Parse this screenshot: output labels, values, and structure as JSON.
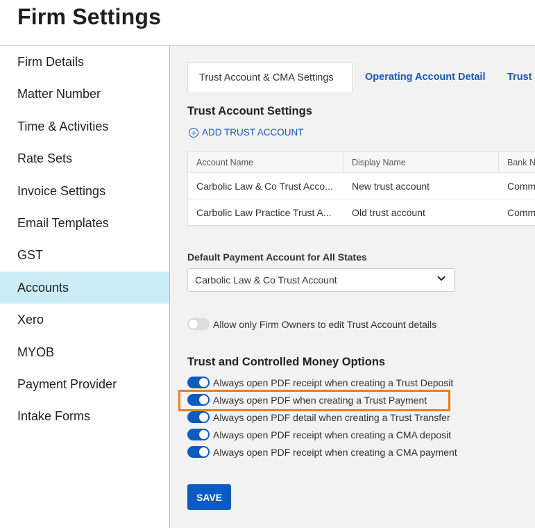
{
  "page_title": "Firm Settings",
  "sidebar": {
    "items": [
      {
        "label": "Firm Details"
      },
      {
        "label": "Matter Number"
      },
      {
        "label": "Time & Activities"
      },
      {
        "label": "Rate Sets"
      },
      {
        "label": "Invoice Settings"
      },
      {
        "label": "Email Templates"
      },
      {
        "label": "GST"
      },
      {
        "label": "Accounts",
        "active": true
      },
      {
        "label": "Xero"
      },
      {
        "label": "MYOB"
      },
      {
        "label": "Payment Provider"
      },
      {
        "label": "Intake Forms"
      }
    ]
  },
  "tabs": [
    {
      "label": "Trust Account & CMA Settings",
      "active": true
    },
    {
      "label": "Operating Account Detail"
    },
    {
      "label": "Trust &"
    }
  ],
  "trust_settings": {
    "title": "Trust Account Settings",
    "add_label": "ADD TRUST ACCOUNT",
    "columns": [
      "Account Name",
      "Display Name",
      "Bank N"
    ],
    "rows": [
      [
        "Carbolic Law & Co Trust Acco...",
        "New trust account",
        "Comm"
      ],
      [
        "Carbolic Law Practice Trust A...",
        "Old trust account",
        "Comm"
      ]
    ]
  },
  "default_payment": {
    "label": "Default Payment Account for All States",
    "value": "Carbolic Law & Co Trust Account"
  },
  "firm_owner_toggle": {
    "label": "Allow only Firm Owners to edit Trust Account details",
    "on": false
  },
  "money_options": {
    "title": "Trust and Controlled Money Options",
    "options": [
      {
        "label": "Always open PDF receipt when creating a Trust Deposit",
        "on": true
      },
      {
        "label": "Always open PDF when creating a Trust Payment",
        "on": true
      },
      {
        "label": "Always open PDF detail when creating a Trust Transfer",
        "on": true
      },
      {
        "label": "Always open PDF receipt when creating a CMA deposit",
        "on": true
      },
      {
        "label": "Always open PDF receipt when creating a CMA payment",
        "on": true
      }
    ]
  },
  "save_label": "SAVE",
  "colors": {
    "accent": "#0b5cc1",
    "link": "#1a56c4",
    "active_sidebar": "#c9ecf5",
    "highlight": "#f07c1b"
  }
}
